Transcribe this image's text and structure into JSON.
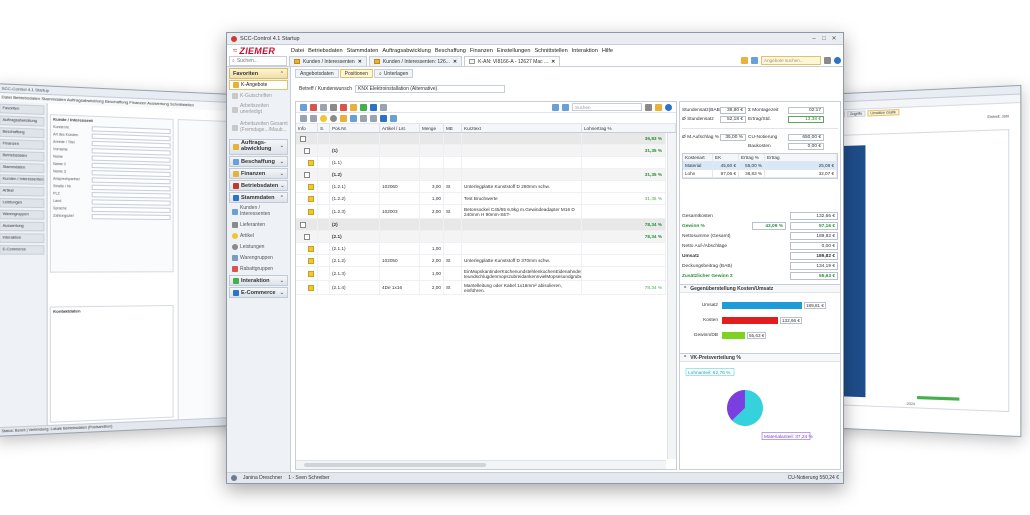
{
  "back_left": {
    "title": "SCC-Control 4.1 Startup",
    "menu": "Datei  Betriebsdaten  Stammdaten  Auftragsabwicklung  Beschaffung  Finanzen  Auswertung  Schnittstellen",
    "nav": [
      "Favoriten",
      "Auftragsabwicklung",
      "Beschaffung",
      "Finanzen",
      "Betriebsdaten",
      "Stammdaten",
      "Kunden / Interessenten",
      "Artikel",
      "Leistungen",
      "Warengruppen",
      "Auswertung",
      "Interaktion",
      "E-Commerce"
    ],
    "form_section": "Kunde / Interessent",
    "fields": [
      "Kundennr.",
      "Art des Kunden",
      "Anrede / Titel",
      "Vorname",
      "Name",
      "Name 2",
      "Name 3",
      "Ansprechpartner",
      "Straße / Nr.",
      "PLZ",
      "Land",
      "Sprache",
      "Zahlungsziel"
    ],
    "grid_section": "Kontaktdaten",
    "status": "Status: Bereit | Verbindung: Lokale Betriebsdaten (Postsandbox)"
  },
  "back_right": {
    "tabs": [
      "Teamverteilung",
      "Kundenmonate",
      "Zugriffe",
      "Umsätze Grafik"
    ],
    "control": "Einheit: Jahr",
    "xlabel": "2024"
  },
  "main": {
    "title": "SCC-Control 4.1 Startup",
    "window_controls": [
      "–",
      "□",
      "✕"
    ],
    "logo": "ZIEMER",
    "menus": [
      "Datei",
      "Betriebsdaten",
      "Stammdaten",
      "Auftragsabwicklung",
      "Beschaffung",
      "Finanzen",
      "Einstellungen",
      "Schnittstellen",
      "Interaktion",
      "Hilfe"
    ],
    "search_placeholder": "Suchen...",
    "doc_tabs": [
      {
        "label": "Kunden / Interessenten"
      },
      {
        "label": "Kunden / Interessenten: 126..."
      },
      {
        "label": "K-AN: VI8166-A - 12627 Mac ..."
      }
    ],
    "toolbar_search": "Angebote suchen...",
    "nav": {
      "favoriten": "Favoriten",
      "k_angebote": "K-Angebote",
      "k_gutschriften": "K-Gutschriften",
      "arbeitszeiten_unerledigt": "Arbeitszeiten unerledigt",
      "arbeitszeiten_gesamt": "Arbeitszeiten Gesamt (Fremdage.../Maub...",
      "auftragsabwicklung": "Auftrags-abwicklung",
      "beschaffung": "Beschaffung",
      "finanzen": "Finanzen",
      "betriebsdaten": "Betriebsdaten",
      "stammdaten": "Stammdaten",
      "kunden": "Kunden / Interessenten",
      "lieferanten": "Lieferanten",
      "artikel": "Artikel",
      "leistungen": "Leistungen",
      "warengruppen": "Warengruppen",
      "rabattgruppen": "Rabattgruppen",
      "interaktion": "Interaktion",
      "ecommerce": "E-Commerce"
    },
    "content_tabs": [
      "Angebotsdaten",
      "Positionen",
      "Unterlagen"
    ],
    "betreff_label": "Betreff / Kundenwunsch",
    "betreff_value": "KNX Elektroinstallation (Alternative)",
    "grid_search": "Suchen",
    "grid_headers": [
      "Info",
      "S.",
      "Pos.Nr.",
      "Artikel / Lst.",
      "Menge",
      "ME",
      "Kurztext",
      "Lohnertrag %"
    ],
    "rows": [
      {
        "pos": "",
        "art": "",
        "menge": "",
        "me": "",
        "text": "",
        "pct": "36,83 %",
        "kind": "grp"
      },
      {
        "pos": "(1)",
        "art": "",
        "menge": "",
        "me": "",
        "text": "",
        "pct": "31,35 %",
        "kind": "sub"
      },
      {
        "pos": "(1.1)",
        "art": "",
        "menge": "",
        "me": "",
        "text": "",
        "pct": "",
        "kind": ""
      },
      {
        "pos": "(1.2)",
        "art": "",
        "menge": "",
        "me": "",
        "text": "",
        "pct": "31,35 %",
        "kind": "sub"
      },
      {
        "pos": "(1.2.1)",
        "art": "102060",
        "menge": "3,00",
        "me": "St",
        "text": "Unterlegplatte Kunststoff D 280mm schw.",
        "pct": "",
        "kind": ""
      },
      {
        "pos": "(1.2.2)",
        "art": "",
        "menge": "1,00",
        "me": "",
        "text": "Test Bruchwerte",
        "pct": "31,35 %",
        "kind": "lt"
      },
      {
        "pos": "(1.2.3)",
        "art": "102003",
        "menge": "2,00",
        "me": "St",
        "text": "Betonsockel C45/55 6,9kg m.Gewindeadapter M16 D 240mm H 90mm-SET-",
        "pct": "",
        "kind": "tall"
      },
      {
        "pos": "(2)",
        "art": "",
        "menge": "",
        "me": "",
        "text": "",
        "pct": "78,34 %",
        "kind": "grp"
      },
      {
        "pos": "(2.1)",
        "art": "",
        "menge": "",
        "me": "",
        "text": "",
        "pct": "78,34 %",
        "kind": "sub"
      },
      {
        "pos": "(2.1.1)",
        "art": "",
        "menge": "1,00",
        "me": "",
        "text": "",
        "pct": "",
        "kind": ""
      },
      {
        "pos": "(2.1.2)",
        "art": "102050",
        "menge": "2,00",
        "me": "St",
        "text": "Unterlegplatte Kunststoff D 370mm schw.",
        "pct": "",
        "kind": ""
      },
      {
        "pos": "(2.1.3)",
        "art": "",
        "menge": "1,00",
        "me": "",
        "text": "EinMopskantinderKüchenundstehlenkochenEidenahnderlochdekel teundschlugdenmopszubreidankennvielMopsesundgruben:hnen:D",
        "pct": "",
        "kind": "tall"
      },
      {
        "pos": "(2.1.4)",
        "art": "4De 1x16",
        "menge": "2,00",
        "me": "St",
        "text": "Mantelleitung oder Kabel 1x16mm² abisolieren, einführen.",
        "pct": "78,34 %",
        "kind": "tall-lt"
      }
    ],
    "info": {
      "stundensatz_label": "Stundensatz(BAB)",
      "stundensatz": "38,80 €",
      "montagezeit_label": "Σ Montagezeit",
      "montagezeit": "02:17",
      "o_stundensatz_label": "Ø Stundensatz",
      "o_stundensatz": "52,18 €",
      "ertrag_std_label": "Ertrag/Std.",
      "ertrag_std": "13,38 €",
      "aufschlag_label": "Ø M.Aufschlag %",
      "aufschlag": "35,00 %",
      "cu_label": "CU-Notierung",
      "cu": "650,00 €",
      "baukosten_label": "Baukosten",
      "baukosten": "0,00 €",
      "kt_headers": [
        "Kostenart",
        "EK",
        "Ertrag %",
        "Ertrag"
      ],
      "kt_rows": [
        [
          "Material",
          "45,60 €",
          "55,00 %",
          "25,08 €"
        ],
        [
          "Lohn",
          "87,06 €",
          "36,83 %",
          "32,07 €"
        ]
      ],
      "summary": [
        {
          "label": "Gesamtkosten",
          "value": "132,66 €",
          "style": ""
        },
        {
          "label": "Gewinn %",
          "value": "57,16 €",
          "pct": "43,09 %",
          "style": "green"
        },
        {
          "label": "Nettosumme (Gesamt)",
          "value": "189,82 €",
          "style": ""
        },
        {
          "label": "Netto Auf-/Abschläge",
          "value": "0,00 €",
          "style": ""
        },
        {
          "label": "Umsatz",
          "value": "189,82 €",
          "style": "bold"
        },
        {
          "label": "Deckungsbeitrag (BAB)",
          "value": "134,19 €",
          "style": ""
        },
        {
          "label": "Zusätzlicher Gewinn Σ",
          "value": "55,63 €",
          "style": "green"
        }
      ],
      "comparison_title": "Gegenüberstellung Kosten/Umsatz",
      "comparison": [
        {
          "label": "Umsatz",
          "value": 189.81,
          "text": "189,81 €",
          "color": "#1f9bd7"
        },
        {
          "label": "Kosten",
          "value": 132.66,
          "text": "132,66 €",
          "color": "#e21d1d"
        },
        {
          "label": "Gewinn/DB",
          "value": 55.63,
          "text": "55,63 €",
          "color": "#7ed321"
        }
      ],
      "pie_title": "VK-Preisverteilung %",
      "pie": [
        {
          "label": "Lohnanteil: 62,76 %",
          "value": 62.76,
          "color": "#35d2de"
        },
        {
          "label": "Materialanteil: 37,24 %",
          "value": 37.24,
          "color": "#7b3fe0"
        }
      ]
    },
    "status_user": "Janina Dreschner",
    "status_user2": "1 - Sven Schreiber",
    "status_right": "CU-Notierung 550,24 €"
  }
}
